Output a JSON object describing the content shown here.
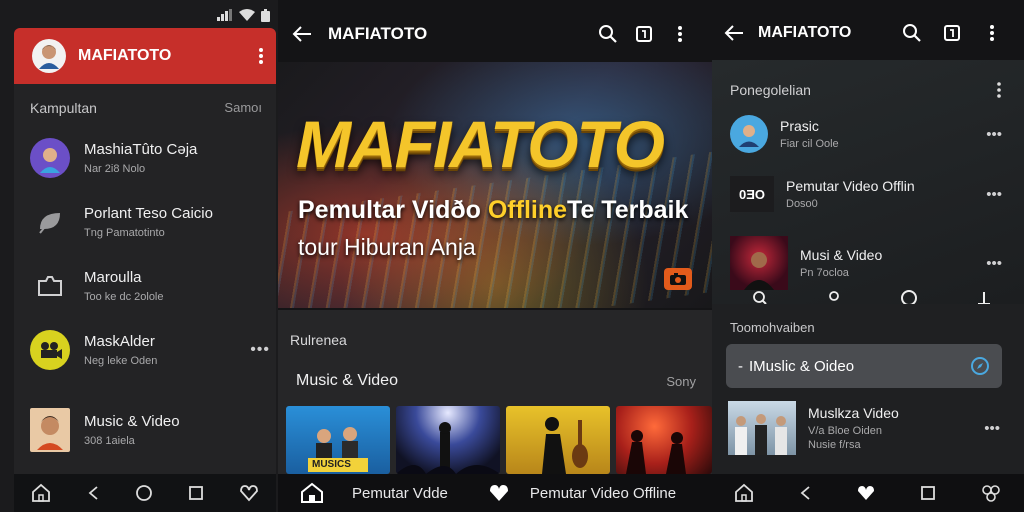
{
  "left": {
    "header_title": "MAFIATOTO",
    "section_label": "Kampultan",
    "section_more": "Samoı",
    "items": [
      {
        "title": "MashiaTûto Cəja",
        "subtitle": "Nar 2i8 Nolo"
      },
      {
        "title": "Porlant Teso Caicio",
        "subtitle": "Tng Pamatotinto"
      },
      {
        "title": "Maroulla",
        "subtitle": "Too ke dc 2olole"
      },
      {
        "title": "MaskAlder",
        "subtitle": "Neg leke Oden"
      },
      {
        "title": "Music & Video",
        "subtitle": "308 1aiela"
      }
    ]
  },
  "middle": {
    "title": "MAFIATOTO",
    "banner": {
      "headline": "MAFIATOTO",
      "line1_a": "Pemultar Vidðo ",
      "line1_hl": "Offline",
      "line1_b": "Te Terbaik",
      "line2": "tour Hiburan Anja"
    },
    "section_caption": "Rulrenea",
    "section_title": "Music & Video",
    "section_more": "Sony",
    "thumb1_caption": "MUSICS",
    "nav_label1": "Pemutar Vdde",
    "nav_label2": "Pemutar Video Offline"
  },
  "right": {
    "title": "MAFIATOTO",
    "card_caption": "Ponegolelian",
    "items": [
      {
        "title": "Prasic",
        "subtitle": "Fiar cil Oole",
        "icon_text": ""
      },
      {
        "title": "Pemutar Video Offlin",
        "subtitle": "Doso0",
        "icon_text": "0ƎO"
      },
      {
        "title": "Musi & Video",
        "subtitle": "Pn 7ocloa",
        "icon_text": ""
      }
    ],
    "lower_caption": "Toomohvaiben",
    "pill_prefix": "-",
    "pill_label": "IMuslic & Oideo",
    "bottom_item": {
      "title": "Muslkza Video",
      "subtitle1": "V/a Bloe Oiden",
      "subtitle2": "Nusie f/rsa"
    }
  },
  "colors": {
    "accent_red": "#c62f2a",
    "accent_yellow": "#f4c52a",
    "accent_blue": "#4aa8e0"
  }
}
